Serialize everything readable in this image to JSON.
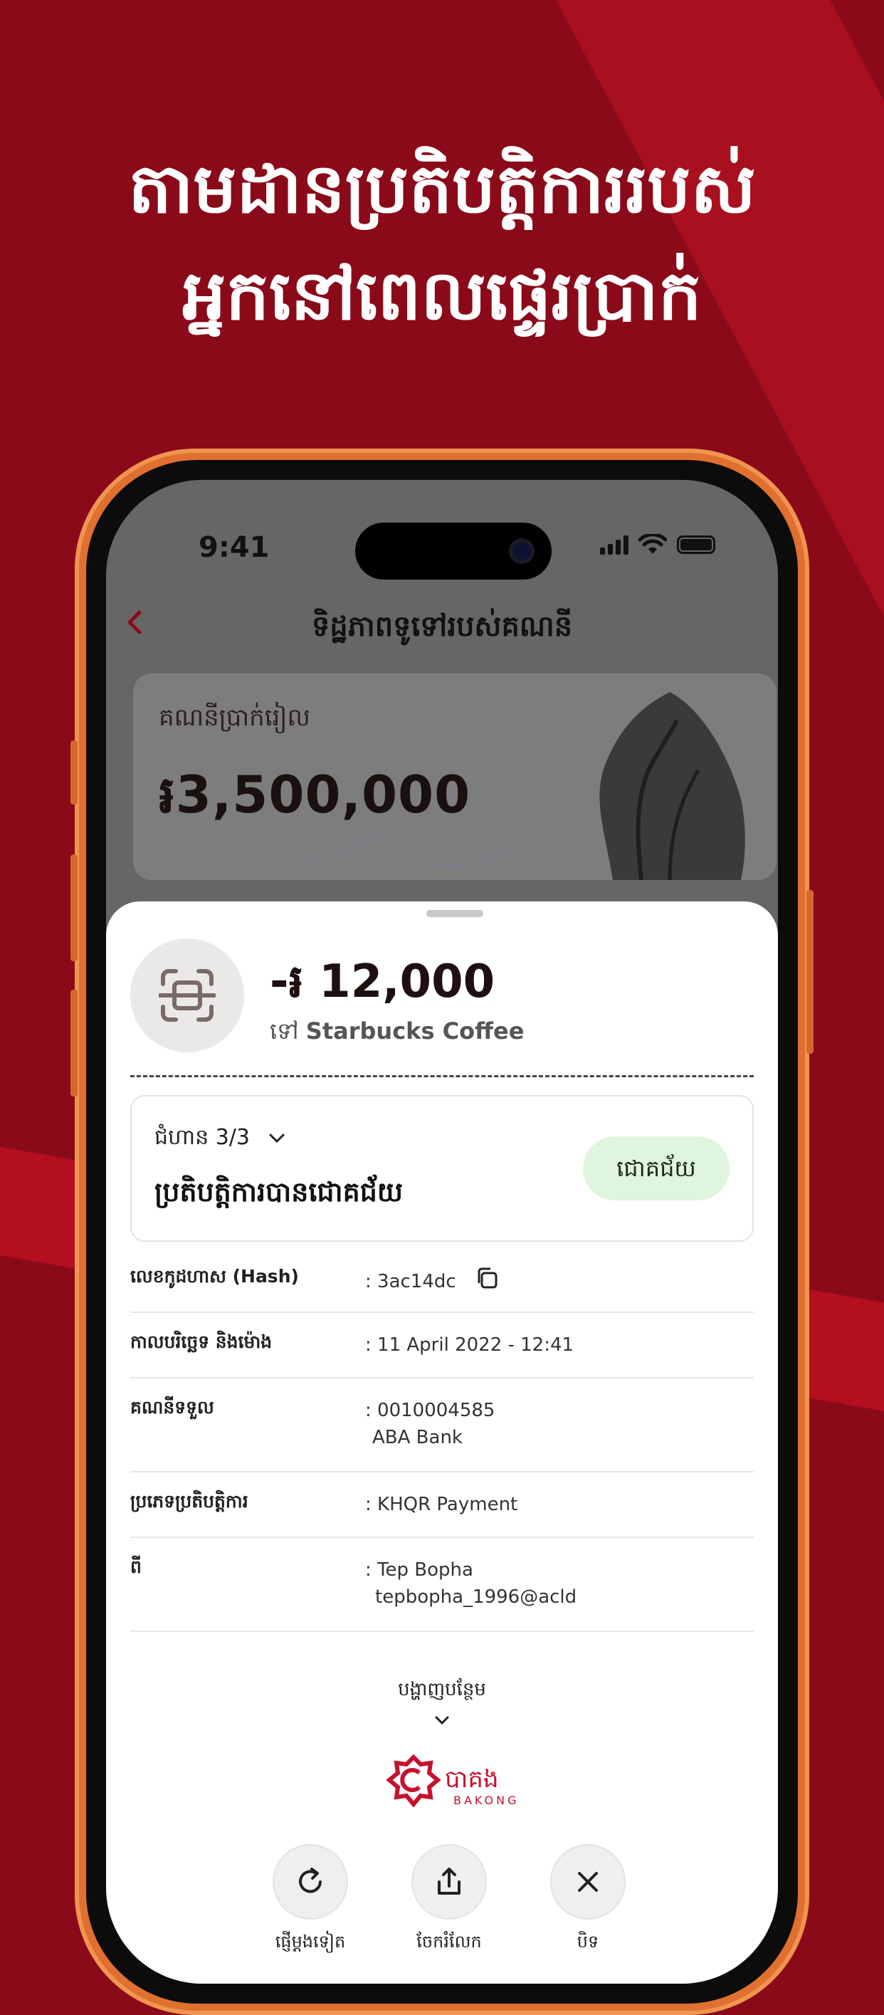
{
  "headline": {
    "line1": "តាមដានប្រតិបត្តិការរបស់",
    "line2": "អ្នកនៅពេលផ្ទេរប្រាក់"
  },
  "status_bar": {
    "time": "9:41"
  },
  "nav": {
    "title": "ទិដ្ឋភាពទូទៅរបស់គណនី"
  },
  "account_card": {
    "label": "គណនីប្រាក់រៀល",
    "amount": "៛3,500,000"
  },
  "transaction": {
    "amount": "-៛ 12,000",
    "to_prefix": "ទៅ",
    "to_name": "Starbucks Coffee",
    "step": "ជំហាន 3/3",
    "status_title": "ប្រតិបត្តិការបានជោគជ័យ",
    "status_badge": "ជោគជ័យ"
  },
  "details": [
    {
      "label": "លេខកូដហាស (Hash)",
      "value": ": 3ac14dc",
      "value2": ""
    },
    {
      "label": "កាលបរិច្ឆេទ និងម៉ោង",
      "value": ": 11 April 2022 - 12:41",
      "value2": ""
    },
    {
      "label": "គណនីទទួល",
      "value": ": 0010004585",
      "value2": "ABA Bank"
    },
    {
      "label": "ប្រភេទប្រតិបត្តិការ",
      "value": ": KHQR Payment",
      "value2": ""
    },
    {
      "label": "ពី",
      "value": ": Tep Bopha",
      "value2": "tepbopha_1996@acld"
    }
  ],
  "show_more": "បង្ហាញបន្ថែម",
  "brand": {
    "name_kh": "បាគង",
    "name_en": "BAKONG"
  },
  "actions": [
    {
      "label": "ផ្ញើម្តងទៀត",
      "icon": "refresh-icon"
    },
    {
      "label": "ចែករំលែក",
      "icon": "share-icon"
    },
    {
      "label": "បិទ",
      "icon": "close-icon"
    }
  ],
  "colors": {
    "brand_red": "#8a0a1a",
    "success_bg": "#dff5dd",
    "phone_frame": "#e07030"
  }
}
